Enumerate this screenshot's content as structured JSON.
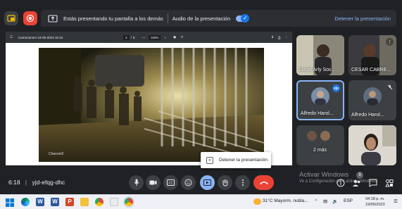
{
  "banner": {
    "presenting_text": "Estás presentando tu pantalla a los demás",
    "audio_label": "Audio de la presentación",
    "stop_label": "Detener la presentación"
  },
  "pdf": {
    "title": "CamScanner 19-05-2023 15.33",
    "page_current": "4",
    "page_sep": "/",
    "page_total": "8",
    "zoom": "183%"
  },
  "photo": {
    "corner_text": "Channel2"
  },
  "participants": [
    {
      "name": "David Arly Sos...",
      "muted": false
    },
    {
      "name": "CESAR CABRE...",
      "muted": false
    },
    {
      "name": "Alfredo Harol...",
      "muted": false,
      "speaking": true
    },
    {
      "name": "Alfredo Harol...",
      "muted": true
    },
    {
      "name": "2 más"
    },
    {
      "name": ""
    }
  ],
  "popup": {
    "label": "Detener la presentación"
  },
  "meeting": {
    "time": "6:18",
    "separator": "|",
    "code": "yjd-efqg-dhc"
  },
  "badge": {
    "count": "9"
  },
  "watermark": {
    "line1": "Activar Windows",
    "line2": "Ve a Configuración para activar Windows."
  },
  "taskbar": {
    "weather": "31°C  Mayorm. nubla...",
    "lang": "ESP",
    "time": "04:18 p. m.",
    "date": "19/05/2023"
  },
  "colors": {
    "bg": "#202124",
    "accent": "#8ab4f8",
    "end_call": "#ea4335",
    "active_control": "#8ab4f8"
  }
}
